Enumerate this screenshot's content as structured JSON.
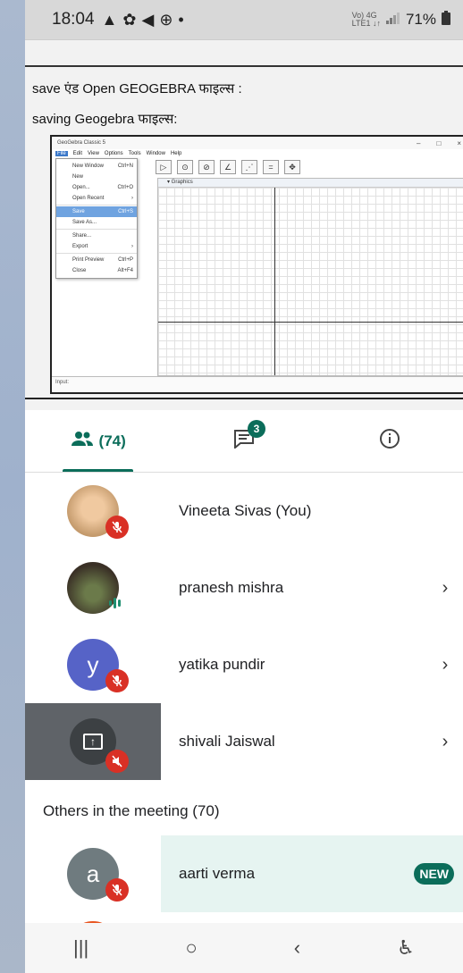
{
  "status": {
    "time": "18:04",
    "left_icons": [
      "▲",
      "✿",
      "◀",
      "⊕",
      "•"
    ],
    "lte_top": "Vo) 4G",
    "lte_bottom": "LTE1 ↓↑",
    "battery": "71%"
  },
  "shared_screen": {
    "line1": "save एंड Open GEOGEBRA फाइल्स :",
    "line2": "saving Geogebra फाइल्स:",
    "app_title": "GeoGebra Classic 5",
    "menu": [
      "File",
      "Edit",
      "View",
      "Options",
      "Tools",
      "Window",
      "Help"
    ],
    "dropdown": [
      {
        "label": "New Window",
        "shortcut": "Ctrl+N"
      },
      {
        "label": "New",
        "shortcut": ""
      },
      {
        "label": "Open...",
        "shortcut": "Ctrl+O"
      },
      {
        "label": "Open Recent",
        "shortcut": "›"
      },
      {
        "label": "Save",
        "shortcut": "Ctrl+S"
      },
      {
        "label": "Save As...",
        "shortcut": ""
      },
      {
        "label": "Share...",
        "shortcut": ""
      },
      {
        "label": "Export",
        "shortcut": "›"
      },
      {
        "label": "Print Preview",
        "shortcut": "Ctrl+P"
      },
      {
        "label": "Close",
        "shortcut": "Alt+F4"
      }
    ],
    "graphics_label": "▾ Graphics",
    "input_label": "Input:"
  },
  "tabs": {
    "people_count": "(74)",
    "chat_badge": "3"
  },
  "participants": [
    {
      "name": "Vineeta Sivas (You)",
      "initial": "",
      "color": "#c49a6c",
      "state": "muted",
      "chevron": ""
    },
    {
      "name": "pranesh mishra",
      "initial": "",
      "color": "#5a4a3a",
      "state": "speaking",
      "chevron": "›"
    },
    {
      "name": "yatika pundir",
      "initial": "y",
      "color": "#5663c7",
      "state": "muted",
      "chevron": "›"
    },
    {
      "name": "shivali Jaiswal",
      "initial": "",
      "color": "#3c4043",
      "state": "presenting",
      "chevron": "›"
    }
  ],
  "others": {
    "title": "Others in the meeting (70)",
    "rows": [
      {
        "name": "aarti verma",
        "initial": "a",
        "color": "#6f7b7f",
        "badge": "NEW"
      }
    ]
  },
  "navbar": {
    "recent": "|||",
    "home": "○",
    "back": "‹",
    "accessibility": "♿"
  }
}
